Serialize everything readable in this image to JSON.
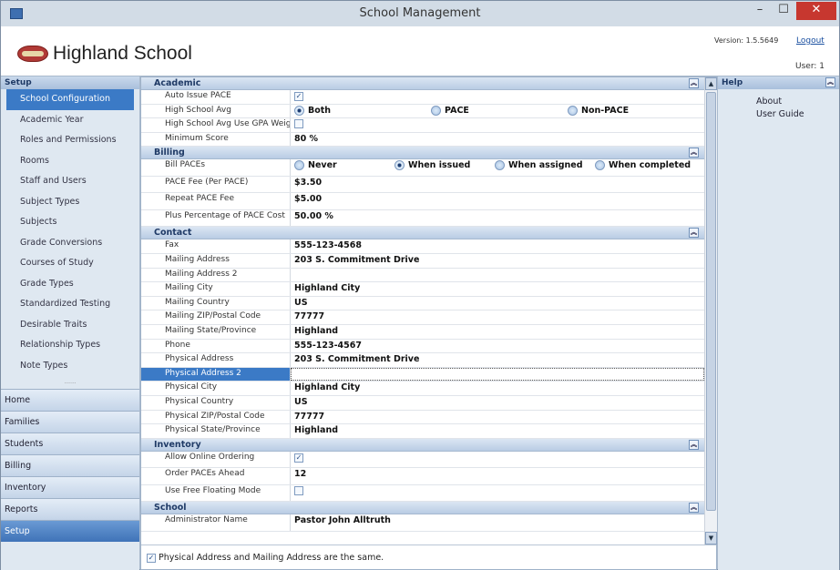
{
  "window": {
    "title": "School Management",
    "min": "–",
    "max": "☐",
    "close": "✕"
  },
  "header": {
    "school_name": "Highland School",
    "version": "Version: 1.5.5649",
    "logout": "Logout",
    "user": "User: 1"
  },
  "sidebar": {
    "title": "Setup",
    "items": [
      "School Configuration",
      "Academic Year",
      "Roles and Permissions",
      "Rooms",
      "Staff and Users",
      "Subject Types",
      "Subjects",
      "Grade Conversions",
      "Courses of Study",
      "Grade Types",
      "Standardized Testing",
      "Desirable Traits",
      "Relationship Types",
      "Note Types"
    ],
    "selected": "School Configuration",
    "sections": [
      "Home",
      "Families",
      "Students",
      "Billing",
      "Inventory",
      "Reports",
      "Setup"
    ],
    "active_section": "Setup"
  },
  "grid": {
    "academic": {
      "title": "Academic",
      "auto_issue_label": "Auto Issue PACE",
      "auto_issue_checked": true,
      "hs_avg_label": "High School Avg",
      "hs_avg_options": [
        "Both",
        "PACE",
        "Non-PACE"
      ],
      "hs_avg_selected": "Both",
      "hs_gpa_label": "High School Avg Use GPA Weigh",
      "hs_gpa_checked": false,
      "min_score_label": "Minimum Score",
      "min_score_value": "80 %"
    },
    "billing": {
      "title": "Billing",
      "bill_label": "Bill PACEs",
      "bill_options": [
        "Never",
        "When issued",
        "When assigned",
        "When completed"
      ],
      "bill_selected": "When issued",
      "fee_label": "PACE Fee  (Per PACE)",
      "fee_value": "$3.50",
      "repeat_label": "Repeat PACE Fee",
      "repeat_value": "$5.00",
      "plus_label": "Plus Percentage of PACE Cost",
      "plus_value": "50.00 %"
    },
    "contact": {
      "title": "Contact",
      "rows": [
        {
          "k": "Fax",
          "v": "555-123-4568"
        },
        {
          "k": "Mailing Address",
          "v": "203 S. Commitment Drive"
        },
        {
          "k": "Mailing Address 2",
          "v": ""
        },
        {
          "k": "Mailing City",
          "v": "Highland City"
        },
        {
          "k": "Mailing Country",
          "v": "US"
        },
        {
          "k": "Mailing ZIP/Postal Code",
          "v": "77777"
        },
        {
          "k": "Mailing State/Province",
          "v": "Highland"
        },
        {
          "k": "Phone",
          "v": "555-123-4567"
        },
        {
          "k": "Physical Address",
          "v": "203 S. Commitment Drive"
        },
        {
          "k": "Physical Address 2",
          "v": ""
        },
        {
          "k": "Physical City",
          "v": "Highland City"
        },
        {
          "k": "Physical Country",
          "v": "US"
        },
        {
          "k": "Physical ZIP/Postal Code",
          "v": "77777"
        },
        {
          "k": "Physical State/Province",
          "v": "Highland"
        }
      ],
      "selected_row": "Physical Address 2"
    },
    "inventory": {
      "title": "Inventory",
      "online_label": "Allow Online Ordering",
      "online_checked": true,
      "ahead_label": "Order PACEs Ahead",
      "ahead_value": "12",
      "floating_label": "Use Free Floating Mode",
      "floating_checked": false
    },
    "school": {
      "title": "School",
      "admin_label": "Administrator Name",
      "admin_value": "Pastor John Alltruth"
    }
  },
  "footer": {
    "checked": true,
    "label": "Physical Address and Mailing Address are the same."
  },
  "help": {
    "title": "Help",
    "links": [
      "About",
      "User Guide"
    ]
  },
  "icons": {
    "collapse": "double-chevron-up-icon",
    "check": "checkmark-icon"
  }
}
